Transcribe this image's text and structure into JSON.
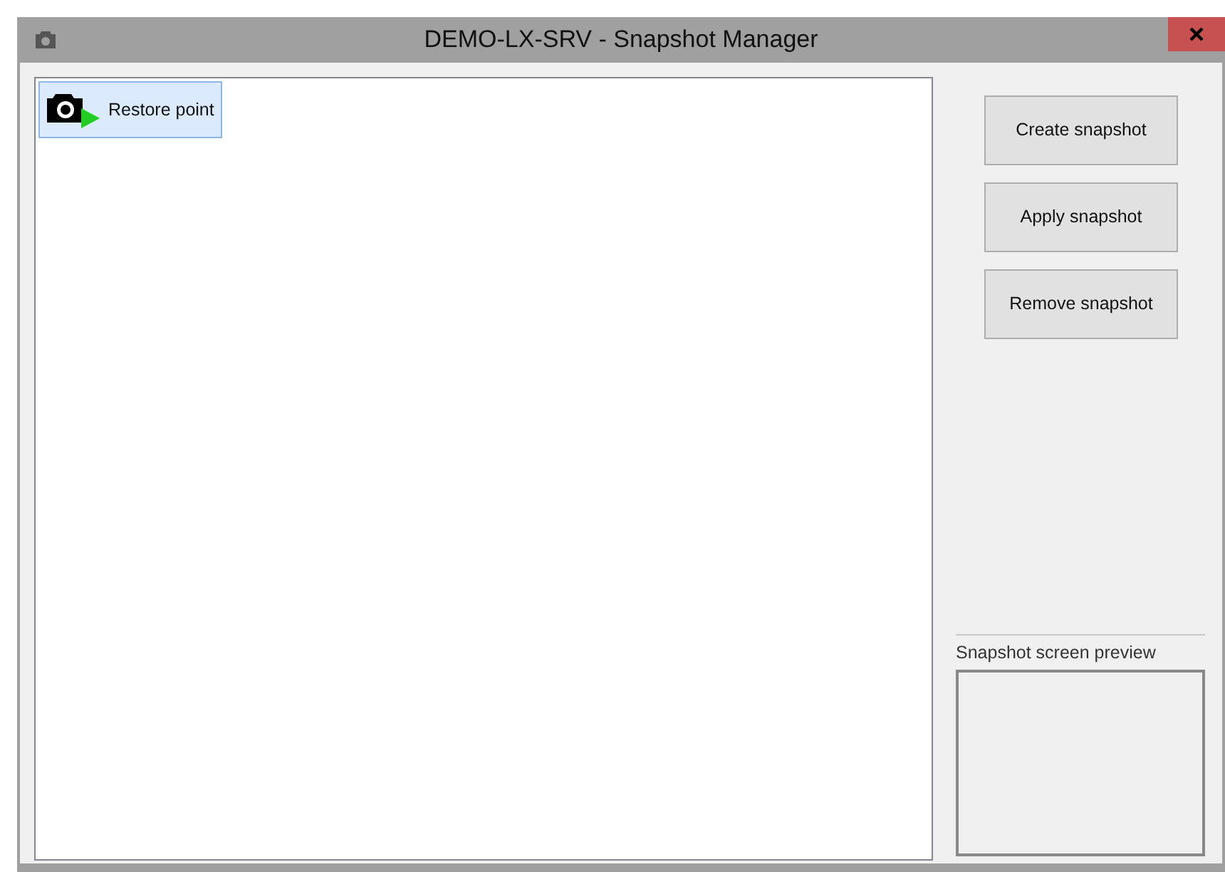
{
  "window": {
    "title": "DEMO-LX-SRV - Snapshot Manager"
  },
  "snapshots": [
    {
      "label": "Restore point",
      "selected": true
    }
  ],
  "buttons": [
    "Create snapshot",
    "Apply snapshot",
    "Remove snapshot"
  ],
  "preview": {
    "label": "Snapshot screen preview"
  }
}
